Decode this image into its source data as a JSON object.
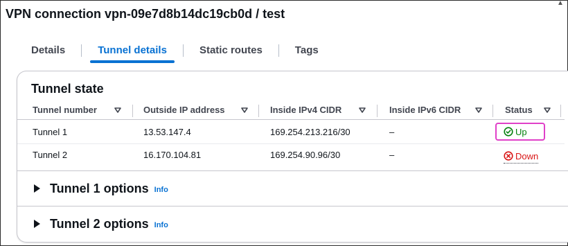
{
  "page": {
    "title": "VPN connection vpn-09e7d8b14dc19cb0d / test"
  },
  "tabs": [
    {
      "label": "Details",
      "active": false
    },
    {
      "label": "Tunnel details",
      "active": true
    },
    {
      "label": "Static routes",
      "active": false
    },
    {
      "label": "Tags",
      "active": false
    }
  ],
  "tunnel_state": {
    "title": "Tunnel state",
    "columns": [
      "Tunnel number",
      "Outside IP address",
      "Inside IPv4 CIDR",
      "Inside IPv6 CIDR",
      "Status"
    ],
    "rows": [
      {
        "tunnel": "Tunnel 1",
        "outside_ip": "13.53.147.4",
        "ipv4_cidr": "169.254.213.216/30",
        "ipv6_cidr": "–",
        "status": "Up",
        "status_icon": "check-circle-icon",
        "status_color": "#037f0c"
      },
      {
        "tunnel": "Tunnel 2",
        "outside_ip": "16.170.104.81",
        "ipv4_cidr": "169.254.90.96/30",
        "ipv6_cidr": "–",
        "status": "Down",
        "status_icon": "x-circle-icon",
        "status_color": "#d91515"
      }
    ]
  },
  "sections": [
    {
      "label": "Tunnel 1 options",
      "info": "Info"
    },
    {
      "label": "Tunnel 2 options",
      "info": "Info"
    }
  ],
  "colors": {
    "accent": "#0972d3",
    "highlight": "#e040c8"
  }
}
